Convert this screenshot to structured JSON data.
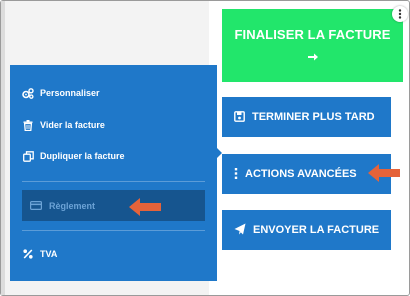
{
  "primary_action": {
    "label": "FINALISER LA FACTURE",
    "icon": "arrow-right-icon",
    "color": "#22e66b"
  },
  "side_actions": [
    {
      "label": "TERMINER PLUS TARD",
      "icon": "save-icon"
    },
    {
      "label": "ACTIONS AVANCÉES",
      "icon": "vertical-ellipsis-icon"
    },
    {
      "label": "ENVOYER LA FACTURE",
      "icon": "paper-plane-icon"
    }
  ],
  "menu": {
    "items": [
      {
        "label": "Personnaliser",
        "icon": "cogs-icon"
      },
      {
        "label": "Vider la facture",
        "icon": "trash-icon"
      },
      {
        "label": "Dupliquer la facture",
        "icon": "copy-icon"
      }
    ],
    "highlighted": {
      "label": "Règlement",
      "icon": "credit-card-icon"
    },
    "footer_item": {
      "label": "TVA",
      "icon": "percent-icon"
    }
  },
  "colors": {
    "button_blue": "#1f78c9",
    "highlight_row": "#16558f",
    "annotation_arrow": "#e5633a"
  }
}
